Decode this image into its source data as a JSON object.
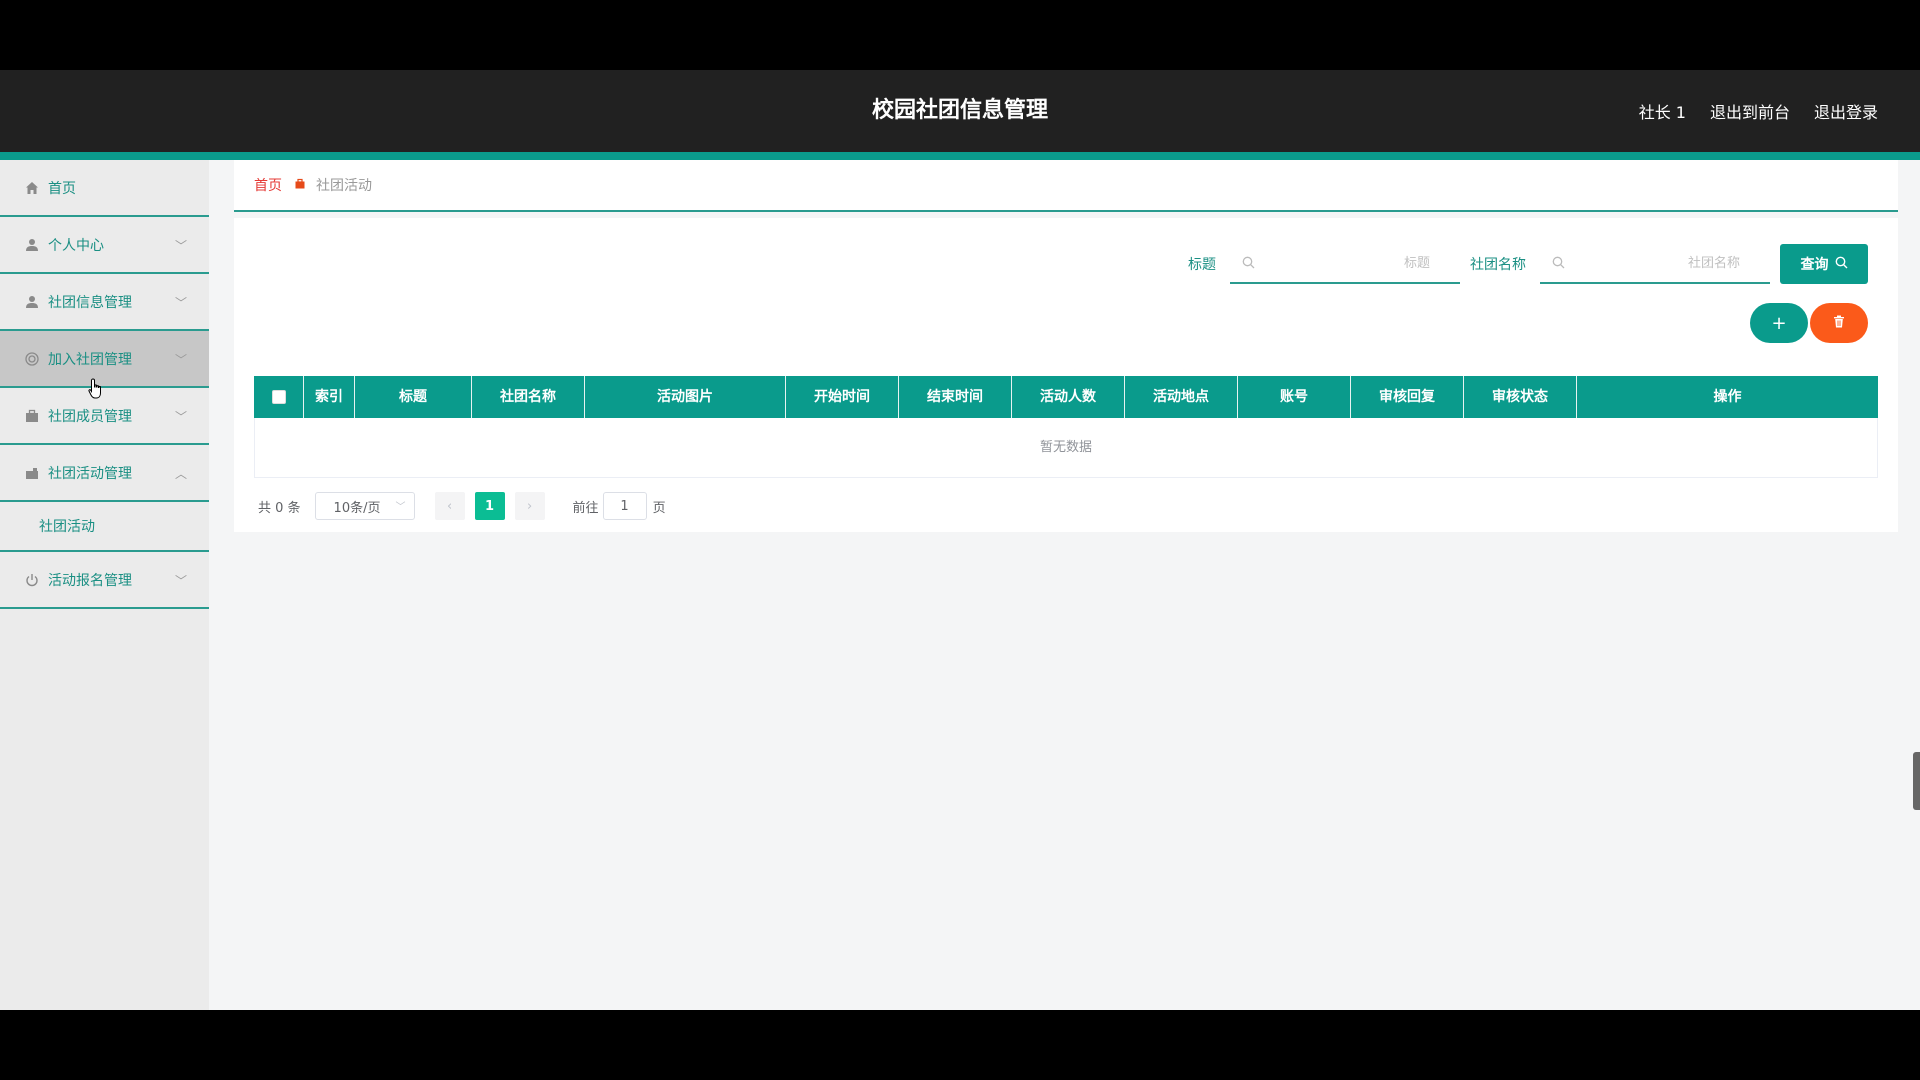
{
  "header": {
    "title": "校园社团信息管理",
    "user": "社长 1",
    "exit_front": "退出到前台",
    "logout": "退出登录"
  },
  "sidebar": {
    "items": [
      {
        "label": "首页",
        "icon": "home-icon"
      },
      {
        "label": "个人中心",
        "icon": "user-icon"
      },
      {
        "label": "社团信息管理",
        "icon": "user-icon"
      },
      {
        "label": "加入社团管理",
        "icon": "target-icon"
      },
      {
        "label": "社团成员管理",
        "icon": "briefcase-icon"
      },
      {
        "label": "社团活动管理",
        "icon": "camera-icon"
      },
      {
        "label": "活动报名管理",
        "icon": "power-icon"
      }
    ],
    "submenu": {
      "label": "社团活动"
    }
  },
  "breadcrumb": {
    "home": "首页",
    "current": "社团活动"
  },
  "search": {
    "title_label": "标题",
    "title_placeholder": "标题",
    "club_label": "社团名称",
    "club_placeholder": "社团名称",
    "query_label": "查询"
  },
  "table": {
    "columns": [
      "索引",
      "标题",
      "社团名称",
      "活动图片",
      "开始时间",
      "结束时间",
      "活动人数",
      "活动地点",
      "账号",
      "审核回复",
      "审核状态",
      "操作"
    ],
    "empty_text": "暂无数据"
  },
  "pagination": {
    "total": "共 0 条",
    "page_size": "10条/页",
    "current_page": "1",
    "goto_label": "前往",
    "goto_value": "1",
    "page_unit": "页"
  },
  "colors": {
    "accent": "#0a9b8c",
    "danger": "#fb5a1a",
    "header_bg": "#212121"
  }
}
